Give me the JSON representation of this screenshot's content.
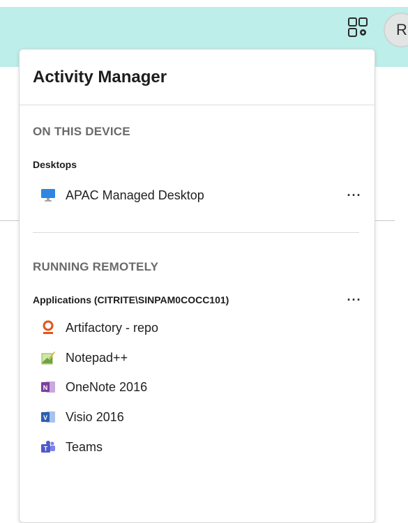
{
  "topbar": {
    "activity_icon": "activity-manager-icon",
    "avatar_initial": "R"
  },
  "panel": {
    "title": "Activity Manager",
    "on_this_device": {
      "heading": "ON THIS DEVICE",
      "group_label": "Desktops",
      "items": [
        {
          "label": "APAC Managed Desktop",
          "icon": "desktop-icon"
        }
      ],
      "more_label": "···"
    },
    "running_remotely": {
      "heading": "RUNNING REMOTELY",
      "group_label": "Applications (CITRITE\\SINPAM0COCC101)",
      "more_label": "···",
      "items": [
        {
          "label": "Artifactory - repo",
          "icon": "artifactory-icon"
        },
        {
          "label": "Notepad++",
          "icon": "notepad-plus-plus-icon"
        },
        {
          "label": "OneNote 2016",
          "icon": "onenote-icon"
        },
        {
          "label": "Visio 2016",
          "icon": "visio-icon"
        },
        {
          "label": "Teams",
          "icon": "teams-icon"
        }
      ]
    }
  },
  "colors": {
    "topbar_bg": "#bdeee9",
    "artifactory_orange": "#e2541e",
    "onenote_purple": "#7b3ea0",
    "visio_blue": "#2e5fb0",
    "teams_purple": "#5059c9",
    "desktop_blue": "#2f86e0"
  }
}
